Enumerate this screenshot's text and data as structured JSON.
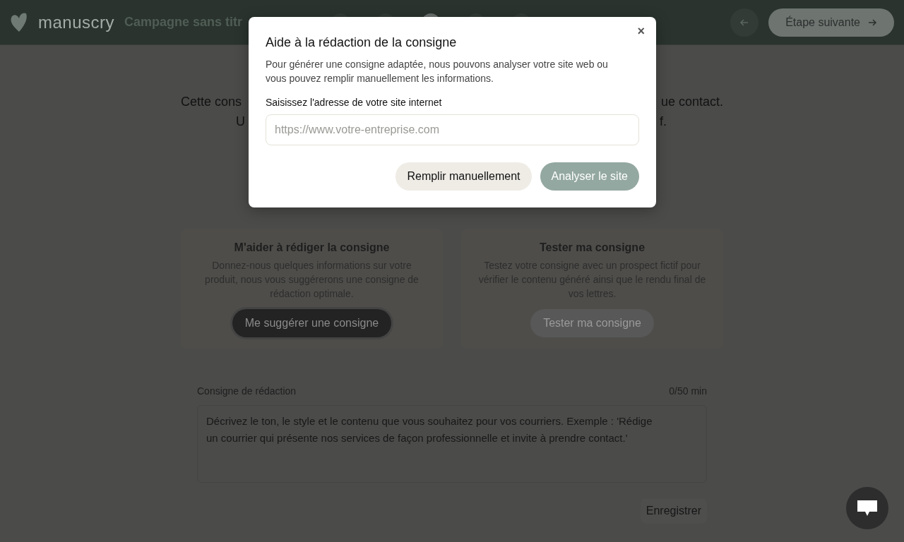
{
  "header": {
    "logo": "manuscry",
    "campaign_title": "Campagne sans titr",
    "steps": [
      {
        "selected": false
      },
      {
        "selected": false
      },
      {
        "selected": true
      },
      {
        "selected": false
      },
      {
        "selected": false
      }
    ],
    "next_button": "Étape suivante"
  },
  "intro": [
    {
      "left": "Cette cons",
      "right": "ue contact."
    },
    {
      "left": "U",
      "right": "f."
    }
  ],
  "cards": [
    {
      "title": "M'aider à rédiger la consigne",
      "text": "Donnez-nous quelques informations sur votre produit, nous vous suggérerons une consigne de rédaction optimale.",
      "button": "Me suggérer une consigne",
      "disabled": false
    },
    {
      "title": "Tester ma consigne",
      "text": "Testez votre consigne avec un prospect fictif pour vérifier le contenu généré ainsi que le rendu final de vos lettres.",
      "button": "Tester ma consigne",
      "disabled": true
    }
  ],
  "editor": {
    "label": "Consigne de rédaction",
    "counter": "0/50 min",
    "placeholder": "Décrivez le ton, le style et le contenu que vous souhaitez pour vos courriers. Exemple : 'Rédige un courrier qui présente nos services de façon professionnelle et invite à prendre contact.'",
    "save_button": "Enregistrer"
  },
  "modal": {
    "title": "Aide à la rédaction de la consigne",
    "description": "Pour générer une consigne adaptée, nous pouvons analyser votre site web ou vous pouvez remplir manuellement les informations.",
    "close": "×",
    "field_label": "Saisissez l'adresse de votre site internet",
    "placeholder": "https://www.votre-entreprise.com",
    "buttons": [
      {
        "label": "Remplir manuellement",
        "kind": "secondary"
      },
      {
        "label": "Analyser le site",
        "kind": "primary"
      }
    ]
  }
}
